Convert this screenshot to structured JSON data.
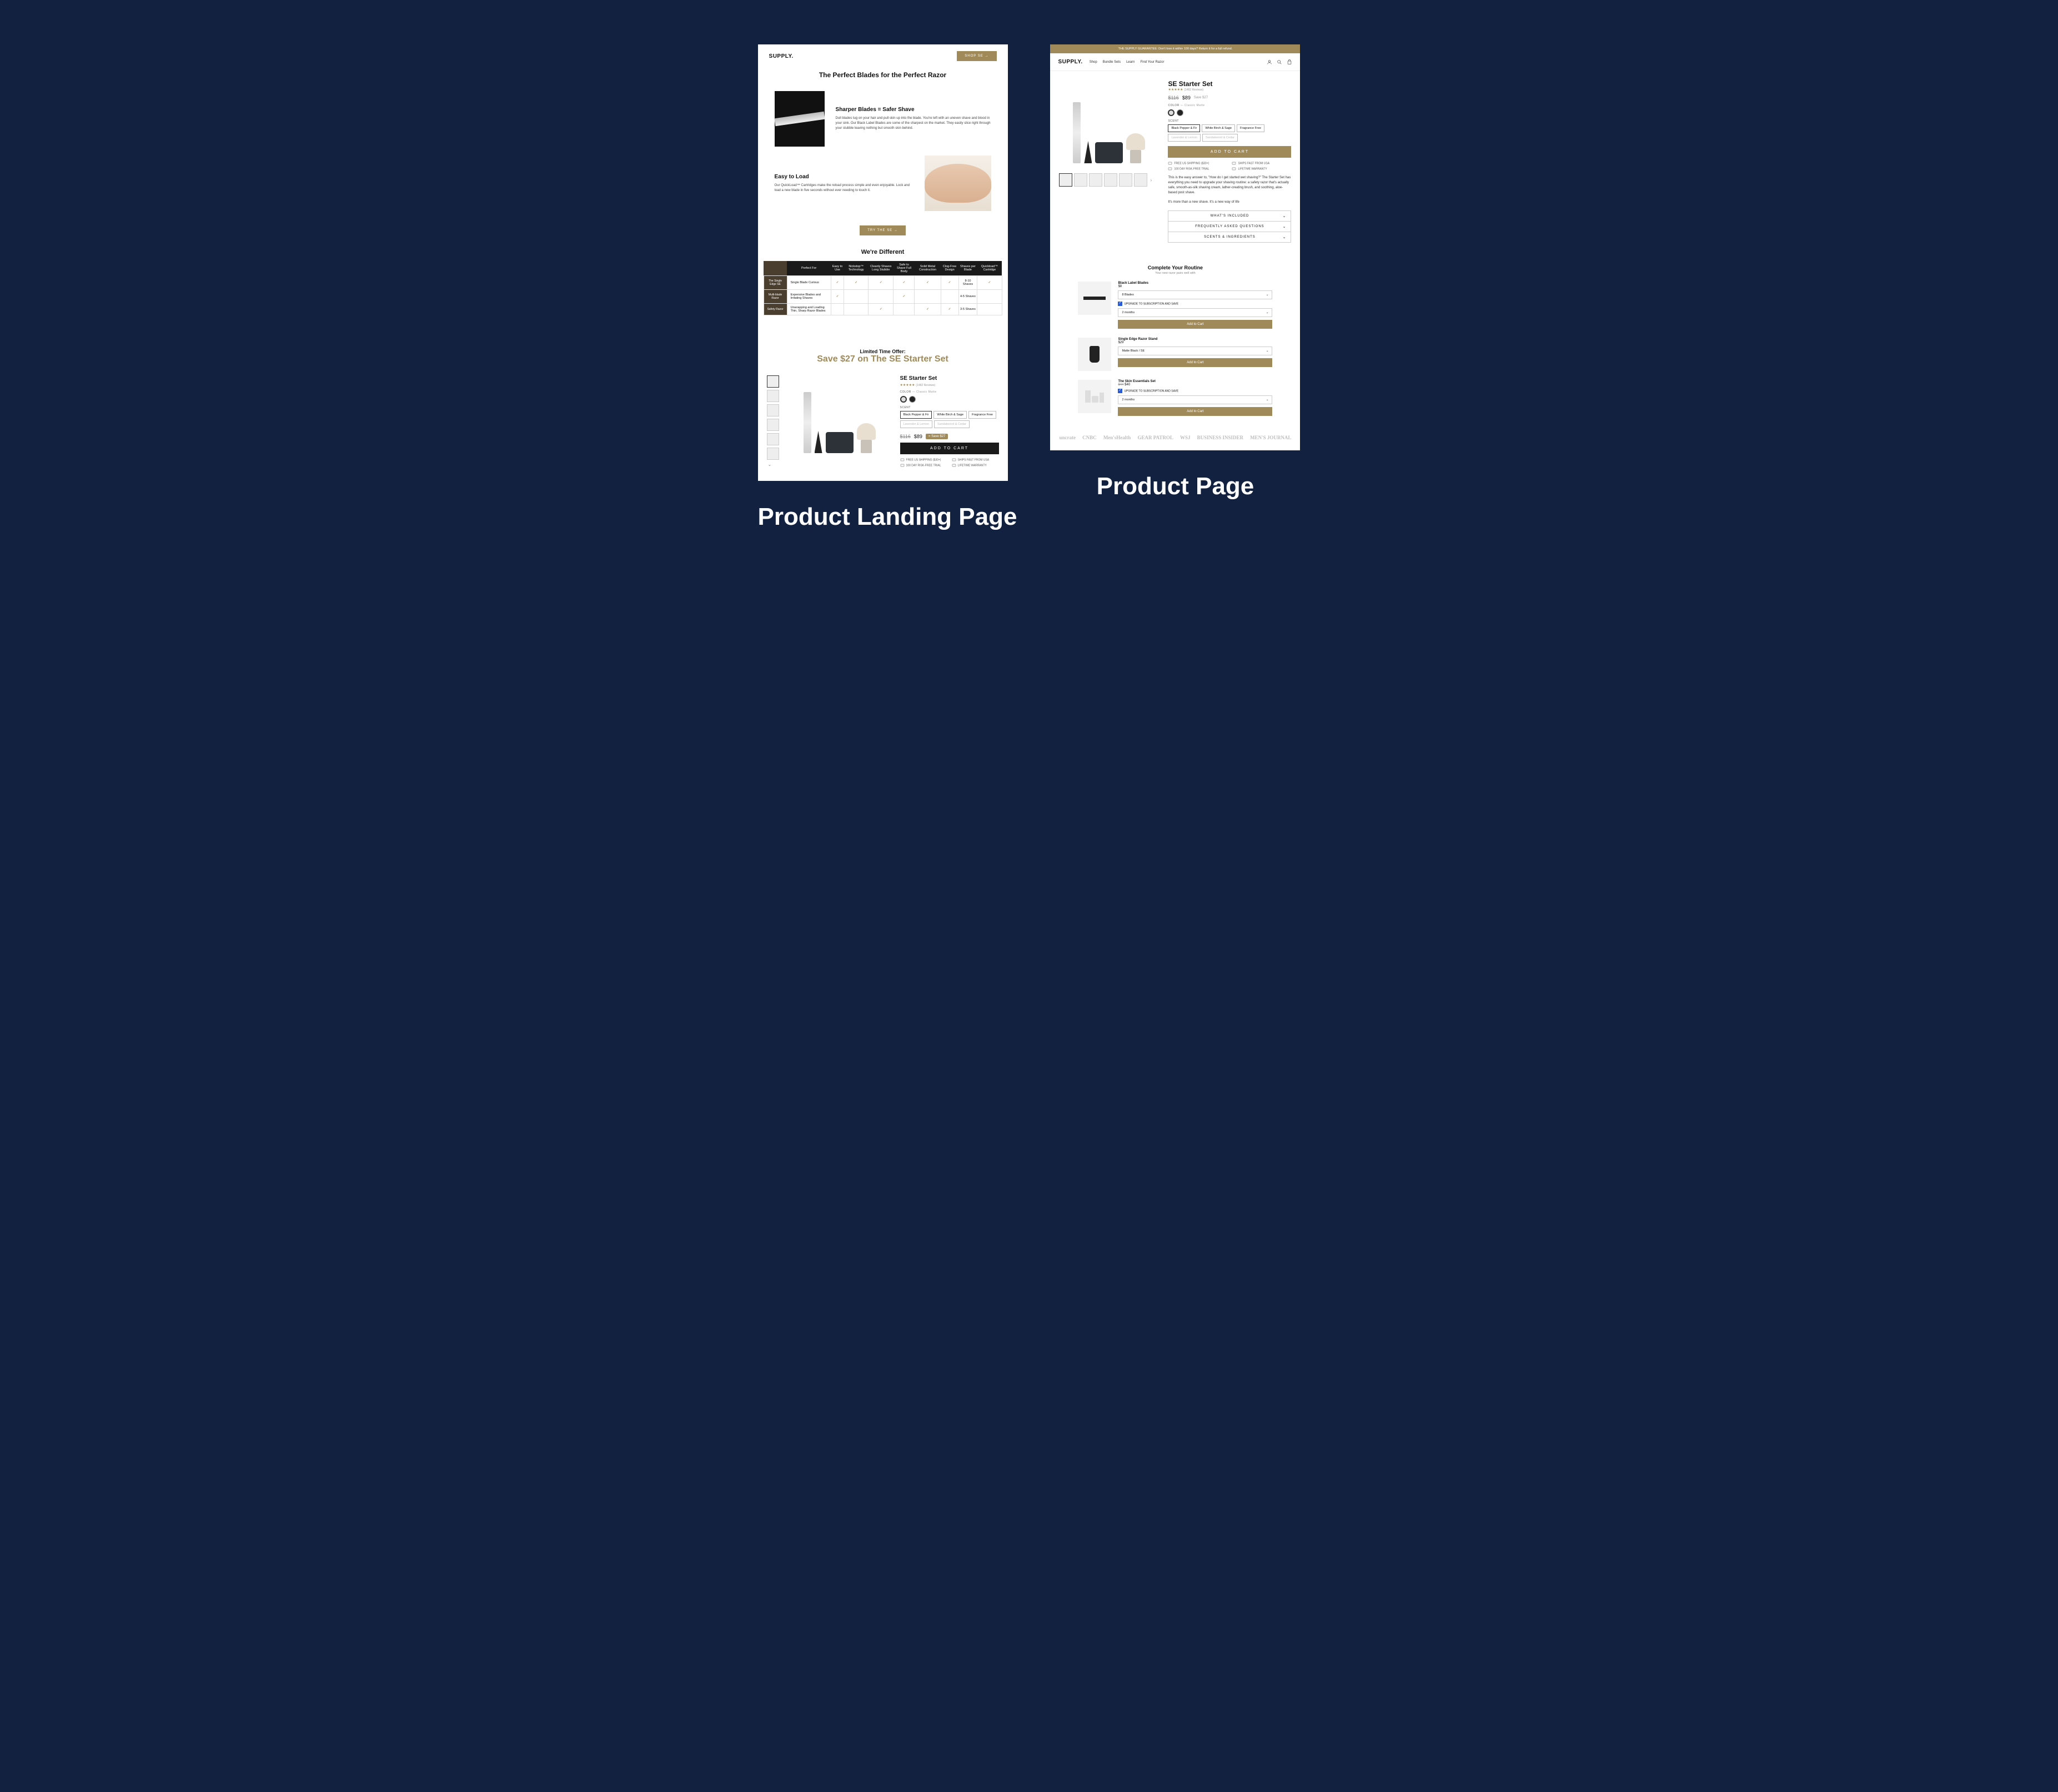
{
  "captions": {
    "left": "Product Landing Page",
    "right": "Product Page"
  },
  "left": {
    "brand": "SUPPLY.",
    "shop_btn": "SHOP SE →",
    "hero_title": "The Perfect Blades for the Perfect Razor",
    "feat1": {
      "title": "Sharper Blades = Safer Shave",
      "body": "Dull blades tug on your hair and pull skin up into the blade. You're left with an uneven shave and blood in your sink. Our Black Label Blades are some of the sharpest on the market. They easily slice right through your stubble leaving nothing but smooth skin behind."
    },
    "feat2": {
      "title": "Easy to Load",
      "body": "Our QuickLoad™ Cartridges make the reload process simple and even enjoyable. Lock and load a new blade in five seconds without ever needing to touch it."
    },
    "try_btn": "TRY THE SE →",
    "diff_title": "We're Different",
    "table": {
      "cols": [
        "",
        "Perfect For",
        "Easy to Use",
        "Nickstop™ Technology",
        "Cleanly Shaves Long Stubble",
        "Safe to Shave Full Body",
        "Solid Metal Construction",
        "Clog-Free Design",
        "Shaves per Blade",
        "Quickload™ Cartridge"
      ],
      "rows": [
        {
          "head": "The Single Edge SE",
          "perfect": "Single Blade Curious",
          "cells": [
            "✓",
            "✓",
            "✓",
            "✓",
            "✓",
            "✓",
            "8-10 Shaves",
            "✓"
          ]
        },
        {
          "head": "Multi-blade Razor",
          "perfect": "Expensive Blades and Irritating Shaves",
          "cells": [
            "✓",
            "",
            "",
            "✓",
            "",
            "",
            "4-5 Shaves",
            ""
          ]
        },
        {
          "head": "Safety Razor",
          "perfect": "Unwrapping and Loading Thin, Sharp Razor Blades",
          "cells": [
            "",
            "",
            "✓",
            "",
            "✓",
            "✓",
            "3-5 Shaves",
            ""
          ]
        }
      ]
    },
    "offer": {
      "small": "Limited Time Offer:",
      "big": "Save $27 on The SE Starter Set"
    },
    "product": {
      "name": "SE Starter Set",
      "reviews": "(1482 Reviews)",
      "color_label": "COLOR",
      "color_value": "— Classic Matte",
      "scent_label": "SCENT",
      "scents": [
        "Black Pepper & Fir",
        "White Birch & Sage",
        "Fragrance Free",
        "Lavender & Lemon",
        "Sandalwood & Cedar"
      ],
      "price_old": "$116",
      "price_new": "$89",
      "save": "= Save $27",
      "atc": "ADD TO CART",
      "perks": [
        "FREE US SHIPPING ($30+)",
        "SHIPS FAST FROM USA",
        "100 DAY RISK-FREE TRIAL",
        "LIFETIME WARRANTY"
      ]
    }
  },
  "right": {
    "banner": "THE SUPPLY GUARANTEE: Don't love it within 100 days? Return it for a full refund.",
    "brand": "SUPPLY.",
    "nav": [
      "Shop",
      "Bundle Sets",
      "Learn",
      "Find Your Razor"
    ],
    "product": {
      "name": "SE Starter Set",
      "reviews": "(1482 Reviews)",
      "price_old": "$116",
      "price_new": "$89",
      "save": "Save $27",
      "color_label": "COLOR",
      "color_value": "— Classic Matte",
      "scent_label": "SCENT",
      "scents": [
        "Black Pepper & Fir",
        "White Birch & Sage",
        "Fragrance Free",
        "Lavender & Lemon",
        "Sandalwood & Cedar"
      ],
      "atc": "ADD TO CART",
      "perks": [
        "FREE US SHIPPING ($30+)",
        "SHIPS FAST FROM USA",
        "100 DAY RISK-FREE TRIAL",
        "LIFETIME WARRANTY"
      ],
      "desc1": "This is the easy answer to, \"How do I get started wet shaving?\" The Starter Set has everything you need to upgrade your shaving routine: a safety razor that's actually safe, smooth-as-silk shaving cream, lather-creating brush, and soothing, aloe-based post shave.",
      "desc2": "It's more than a new shave. It's a new way of life",
      "accordion": [
        "WHAT'S INCLUDED",
        "FREQUENTLY ASKED QUESTIONS",
        "SCENTS & INGREDIENTS"
      ]
    },
    "routine_title": "Complete Your Routine",
    "routine_sub": "Your new razor pairs well with",
    "upsells": [
      {
        "name": "Black Label Blades",
        "price": "$8",
        "opt": "8 Blades",
        "sub": "UPGRADE TO SUBSCRIPTION AND SAVE",
        "int": "2 months",
        "atc": "Add to Cart"
      },
      {
        "name": "Single Edge Razor Stand",
        "price": "$29",
        "opt": "Matte Black / SE",
        "atc": "Add to Cart"
      },
      {
        "name": "The Skin Essentials Set",
        "price_old": "$44",
        "price": "$40",
        "sub": "UPGRADE TO SUBSCRIPTION AND SAVE",
        "int": "2 months",
        "atc": "Add to Cart"
      }
    ],
    "press": [
      "uncrate",
      "CNBC",
      "Men'sHealth",
      "GEAR PATROL",
      "WSJ",
      "BUSINESS INSIDER",
      "MEN'S JOURNAL"
    ]
  }
}
